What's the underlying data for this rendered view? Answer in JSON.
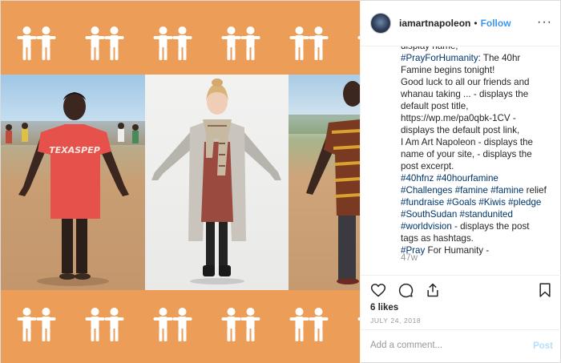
{
  "header": {
    "username": "iamartnapoleon",
    "separator": "•",
    "follow_label": "Follow",
    "more_label": "···"
  },
  "caption": {
    "lines": [
      {
        "parts": [
          {
            "t": "display name,",
            "tag": false
          }
        ]
      },
      {
        "parts": [
          {
            "t": "#PrayForHumanity",
            "tag": true
          },
          {
            "t": ": The 40hr",
            "tag": false
          }
        ]
      },
      {
        "parts": [
          {
            "t": "Famine begins tonight!",
            "tag": false
          }
        ]
      },
      {
        "parts": [
          {
            "t": "Good luck to all our friends and",
            "tag": false
          }
        ]
      },
      {
        "parts": [
          {
            "t": "whanau taking ... - displays the",
            "tag": false
          }
        ]
      },
      {
        "parts": [
          {
            "t": "default post title,",
            "tag": false
          }
        ]
      },
      {
        "parts": [
          {
            "t": "https://wp.me/pa0qbk-1CV -",
            "tag": false
          }
        ]
      },
      {
        "parts": [
          {
            "t": "displays the default post link,",
            "tag": false
          }
        ]
      },
      {
        "parts": [
          {
            "t": "I Am Art Napoleon - displays the",
            "tag": false
          }
        ]
      },
      {
        "parts": [
          {
            "t": "name of your site, - displays the",
            "tag": false
          }
        ]
      },
      {
        "parts": [
          {
            "t": "post excerpt.",
            "tag": false
          }
        ]
      },
      {
        "parts": [
          {
            "t": "#40hfnz",
            "tag": true
          },
          {
            "t": " ",
            "tag": false
          },
          {
            "t": "#40hourfamine",
            "tag": true
          }
        ]
      },
      {
        "parts": [
          {
            "t": "#Challenges",
            "tag": true
          },
          {
            "t": " ",
            "tag": false
          },
          {
            "t": "#famine",
            "tag": true
          },
          {
            "t": " ",
            "tag": false
          },
          {
            "t": "#famine",
            "tag": true
          },
          {
            "t": " relief",
            "tag": false
          }
        ]
      },
      {
        "parts": [
          {
            "t": "#fundraise",
            "tag": true
          },
          {
            "t": " ",
            "tag": false
          },
          {
            "t": "#Goals",
            "tag": true
          },
          {
            "t": " ",
            "tag": false
          },
          {
            "t": "#Kiwis",
            "tag": true
          },
          {
            "t": " ",
            "tag": false
          },
          {
            "t": "#pledge",
            "tag": true
          }
        ]
      },
      {
        "parts": [
          {
            "t": "#SouthSudan",
            "tag": true
          },
          {
            "t": " ",
            "tag": false
          },
          {
            "t": "#standunited",
            "tag": true
          }
        ]
      },
      {
        "parts": [
          {
            "t": "#worldvision",
            "tag": true
          },
          {
            "t": " - displays the post",
            "tag": false
          }
        ]
      },
      {
        "parts": [
          {
            "t": "tags as hashtags.",
            "tag": false
          }
        ]
      },
      {
        "parts": [
          {
            "t": "#Pray",
            "tag": true
          },
          {
            "t": " For Humanity -",
            "tag": false
          }
        ]
      }
    ],
    "age": "47w"
  },
  "actions": {
    "likes": "6 likes",
    "date": "JULY 24, 2018"
  },
  "comment": {
    "placeholder": "Add a comment...",
    "post_label": "Post"
  },
  "image": {
    "shirt_text": "TEXASPEP"
  },
  "colors": {
    "band": "#ec9d58",
    "follow": "#3897f0",
    "hashtag": "#003569",
    "post_disabled": "#b2dffc"
  }
}
